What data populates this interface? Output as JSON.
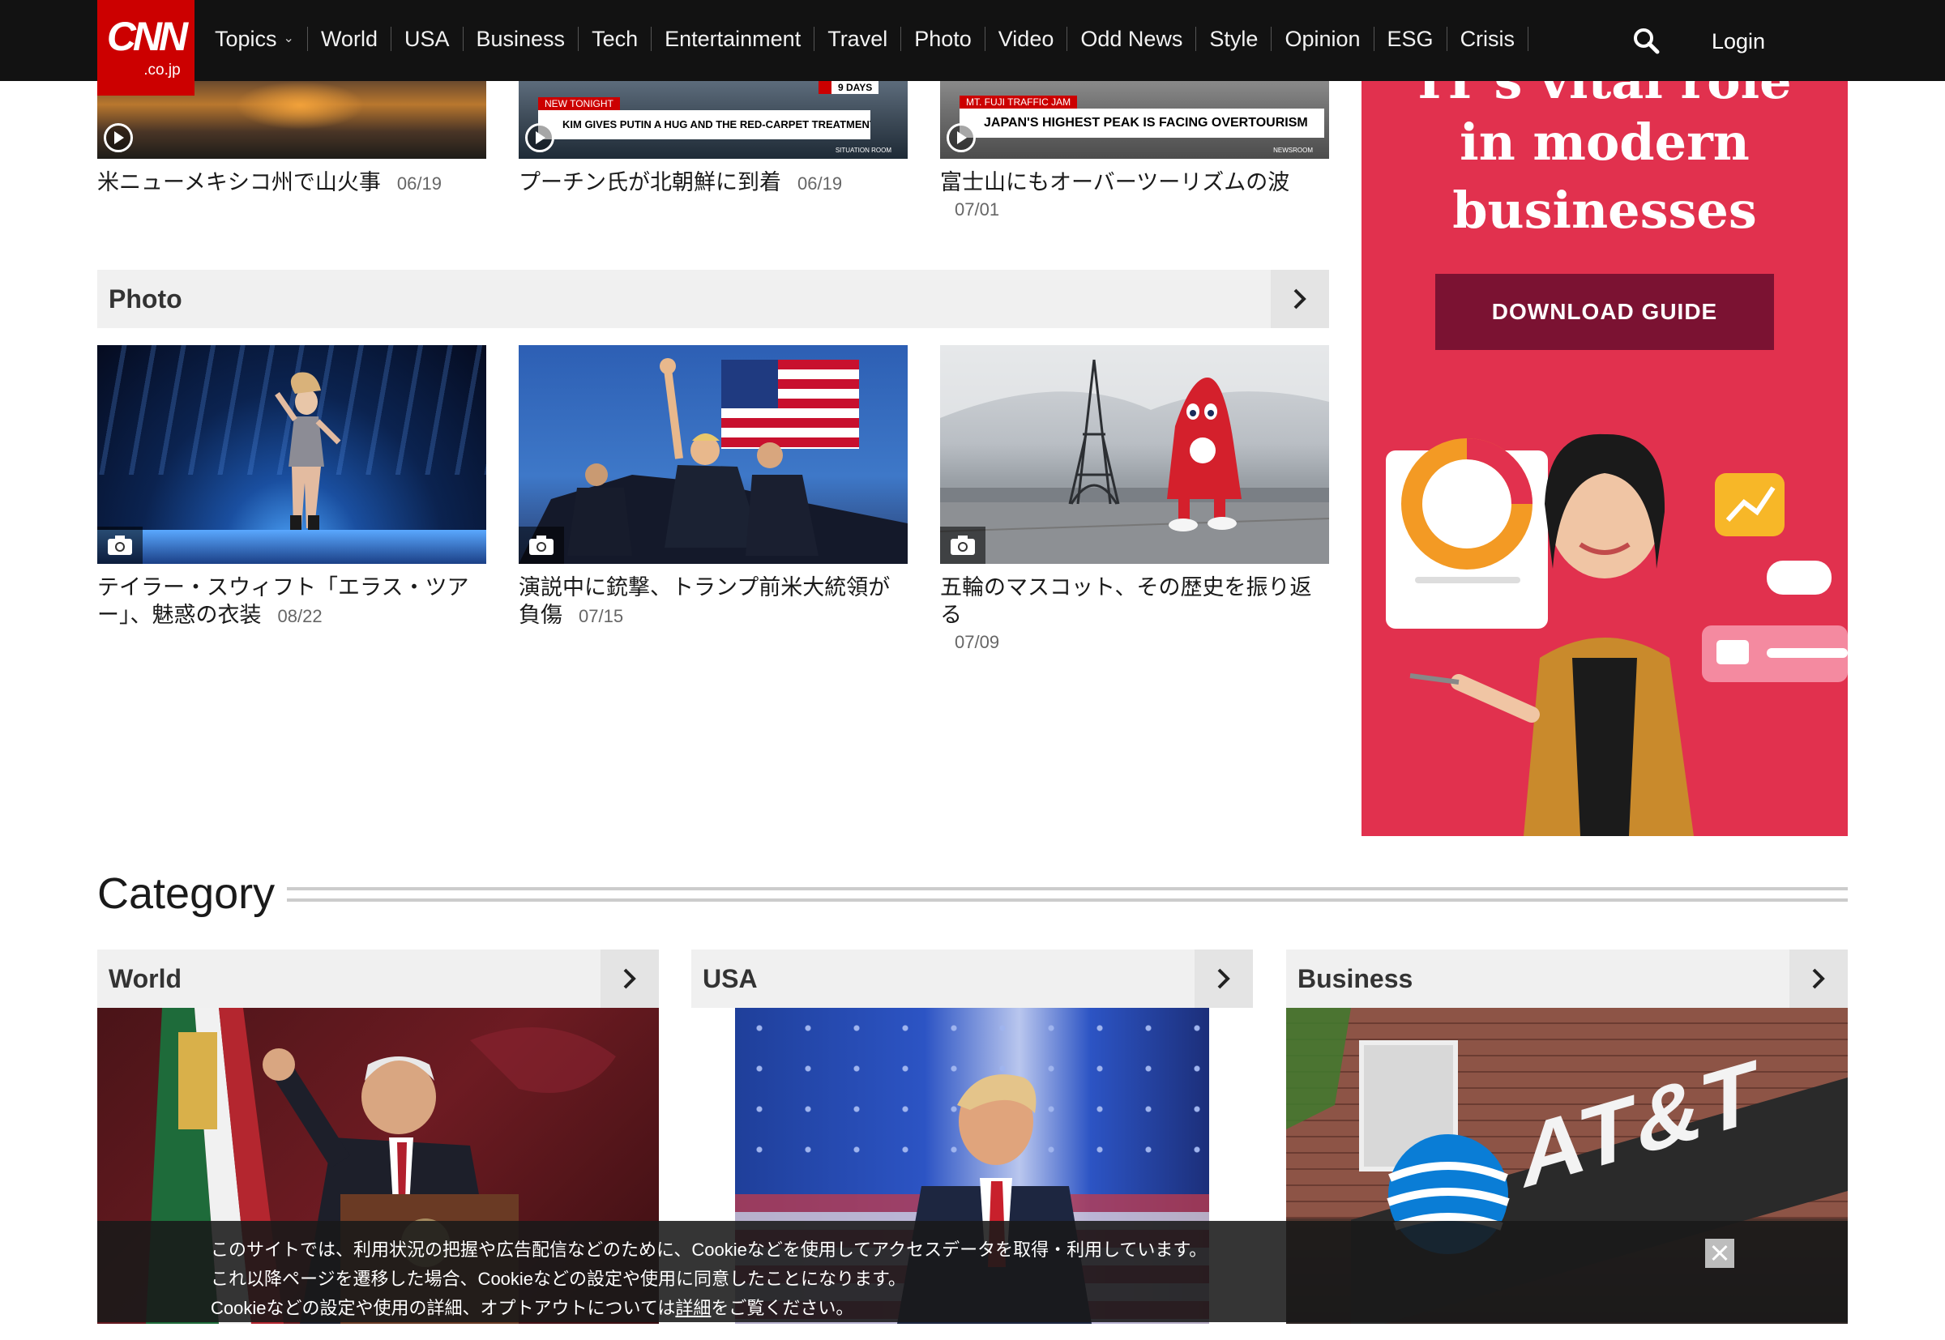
{
  "nav": {
    "logo_text": "CNN",
    "logo_sub": ".co.jp",
    "items": [
      "Topics",
      "World",
      "USA",
      "Business",
      "Tech",
      "Entertainment",
      "Travel",
      "Photo",
      "Video",
      "Odd News",
      "Style",
      "Opinion",
      "ESG",
      "Crisis"
    ],
    "login": "Login"
  },
  "video_row": [
    {
      "title": "米ニューメキシコ州で山火事",
      "date": "06/19"
    },
    {
      "title": "プーチン氏が北朝鮮に到着",
      "date": "06/19",
      "badge": "9 DAYS",
      "tag": "NEW TONIGHT",
      "strip": "KIM GIVES PUTIN A HUG AND THE RED-CARPET TREATMENT AS HE ARRIVES IN NK",
      "sub": "SITUATION ROOM"
    },
    {
      "title": "富士山にもオーバーツーリズムの波",
      "date": "07/01",
      "tag": "MT. FUJI TRAFFIC JAM",
      "strip": "JAPAN'S HIGHEST PEAK IS FACING OVERTOURISM",
      "sub": "NEWSROOM"
    }
  ],
  "photo_section": {
    "title": "Photo",
    "items": [
      {
        "title": "テイラー・スウィフト「エラス・ツアー」、魅惑の衣装",
        "date": "08/22"
      },
      {
        "title": "演説中に銃撃、トランプ前米大統領が負傷",
        "date": "07/15"
      },
      {
        "title": "五輪のマスコット、その歴史を振り返る",
        "date": "07/09"
      }
    ]
  },
  "ad": {
    "line1": "IT's vital role",
    "line2": "in modern",
    "line3": "businesses",
    "button": "DOWNLOAD GUIDE",
    "accent": "#e1314e"
  },
  "category": {
    "title": "Category",
    "items": [
      {
        "title": "World"
      },
      {
        "title": "USA"
      },
      {
        "title": "Business"
      }
    ]
  },
  "cookie": {
    "line1": "このサイトでは、利用状況の把握や広告配信などのために、Cookieなどを使用してアクセスデータを取得・利用しています。",
    "line2": "これ以降ページを遷移した場合、Cookieなどの設定や使用に同意したことになります。",
    "line3_pre": "Cookieなどの設定や使用の詳細、オプトアウトについては",
    "line3_link": "詳細",
    "line3_post": "をご覧ください。"
  }
}
